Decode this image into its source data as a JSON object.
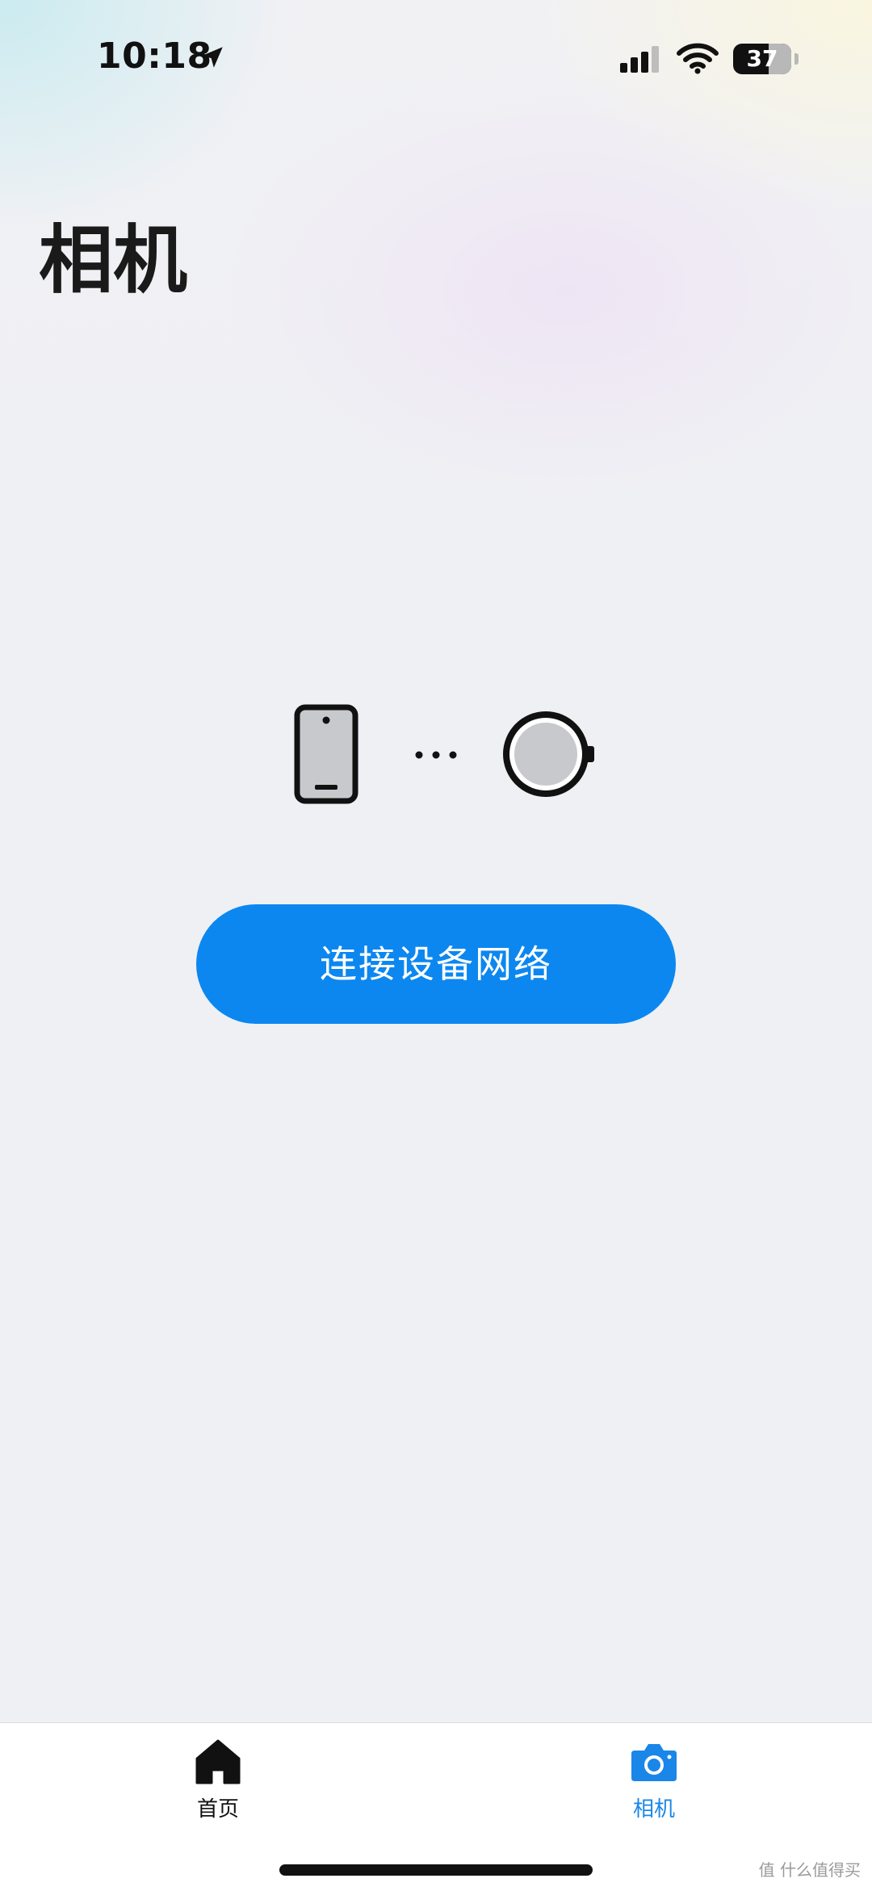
{
  "status_bar": {
    "time": "10:18",
    "battery_level": "37",
    "icons": [
      "location-arrow-icon",
      "cellular-signal-icon",
      "wifi-icon",
      "battery-icon"
    ]
  },
  "page": {
    "title": "相机"
  },
  "illustration": {
    "icons": [
      "phone-icon",
      "ellipsis-icon",
      "watch-icon"
    ]
  },
  "connect_button": {
    "label": "连接设备网络"
  },
  "tab_bar": {
    "tabs": [
      {
        "label": "首页",
        "icon": "home-icon",
        "active": false
      },
      {
        "label": "相机",
        "icon": "camera-icon",
        "active": true
      }
    ]
  },
  "watermark": {
    "text": "值 什么值得买"
  },
  "colors": {
    "accent": "#0c87f0",
    "tab_active": "#1a86e8",
    "background": "#eef0f4",
    "text": "#1a1a1a"
  }
}
